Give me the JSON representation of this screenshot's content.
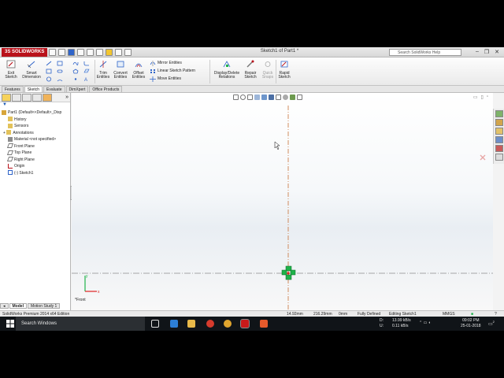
{
  "titlebar": {
    "app_name": "SOLIDWORKS",
    "window_title": "Sketch1 of Part1 *",
    "help_search_placeholder": "Search SolidWorks Help",
    "min": "–",
    "restore": "❐",
    "close": "✕"
  },
  "command_manager": {
    "exit_sketch": "Exit Sketch",
    "smart_dimension": "Smart Dimension",
    "trim_entities": "Trim Entities",
    "convert_entities": "Convert Entities",
    "offset_entities": "Offset Entities",
    "mirror_entities": "Mirror Entities",
    "linear_sketch_pattern": "Linear Sketch Pattern",
    "move_entities": "Move Entities",
    "display_delete_relations": "Display/Delete Relations",
    "repair_sketch": "Repair Sketch",
    "quick_snaps": "Quick Snaps",
    "rapid_sketch": "Rapid Sketch"
  },
  "tabs": [
    "Features",
    "Sketch",
    "Evaluate",
    "DimXpert",
    "Office Products"
  ],
  "active_tab": "Sketch",
  "feature_tree": {
    "root": "Part1  (Default<<Default>_Disp",
    "items": [
      "History",
      "Sensors",
      "Annotations",
      "Material <not specified>",
      "Front Plane",
      "Top Plane",
      "Right Plane",
      "Origin",
      "(-) Sketch1"
    ]
  },
  "panel_bottom_tabs": [
    "Model",
    "Motion Study 1"
  ],
  "graphics": {
    "view_label": "*Front",
    "axis_y": "y",
    "axis_x": "x"
  },
  "statusbar": {
    "edition": "SolidWorks Premium 2014 x64 Edition",
    "x": "14.92mm",
    "y": "216.29mm",
    "z": "0mm",
    "definition": "Fully Defined",
    "editing": "Editing Sketch1",
    "units": "MMGS"
  },
  "taskbar": {
    "search_placeholder": "Search Windows",
    "net_down_label": "D:",
    "net_up_label": "U:",
    "net_down": "13.99 kB/s",
    "net_up": "0.11 kB/s",
    "time": "09:02 PM",
    "date": "25-01-2018",
    "notifications": "2"
  },
  "colors": {
    "brand_red": "#b9121b",
    "origin_green": "#1fb24a",
    "centerline_orange": "#c8733a",
    "centerline_gray": "#8c8c8c"
  }
}
